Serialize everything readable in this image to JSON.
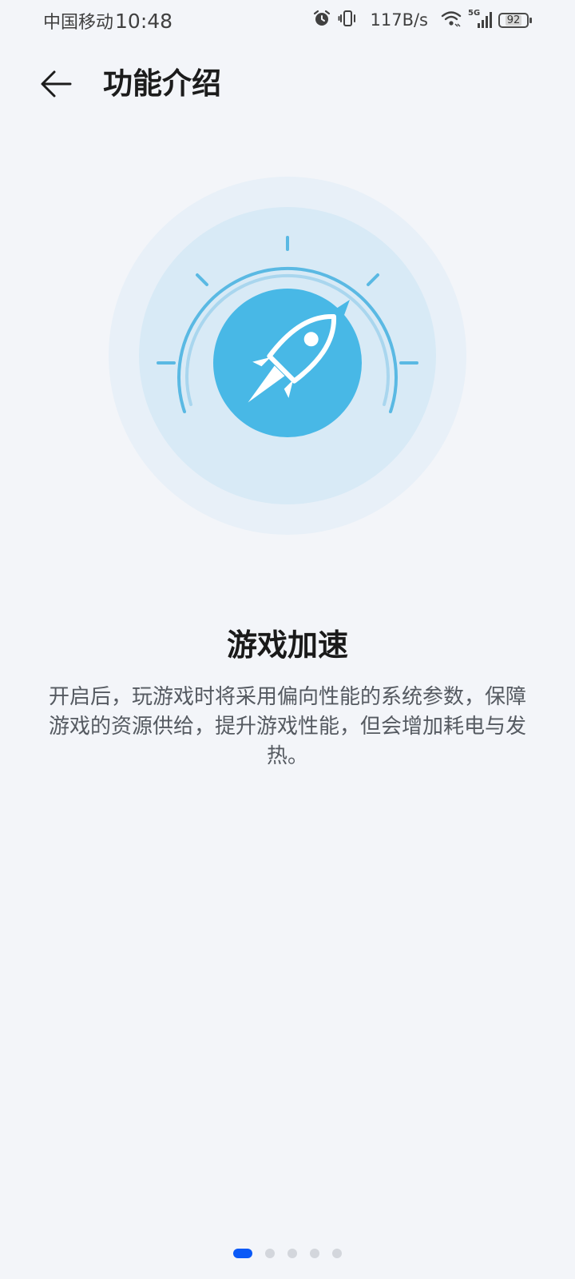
{
  "status_bar": {
    "carrier": "中国移动",
    "time": "10:48",
    "net_speed": "117B/s",
    "network_type": "5G",
    "battery": "92",
    "icons": [
      "alarm-icon",
      "vibrate-icon",
      "wifi-icon",
      "signal-icon",
      "battery-icon"
    ]
  },
  "header": {
    "back_icon": "back-arrow-icon",
    "title": "功能介绍"
  },
  "feature": {
    "illustration": "rocket-speed-gauge-icon",
    "title": "游戏加速",
    "description": "开启后，玩游戏时将采用偏向性能的系统参数，保障游戏的资源供给，提升游戏性能，但会增加耗电与发热。"
  },
  "pager": {
    "total": 5,
    "current": 1
  },
  "colors": {
    "background": "#f3f5f9",
    "accent": "#0a59f7",
    "rocket_blue": "#48b8e6",
    "gauge_line": "#5ab9e3"
  }
}
